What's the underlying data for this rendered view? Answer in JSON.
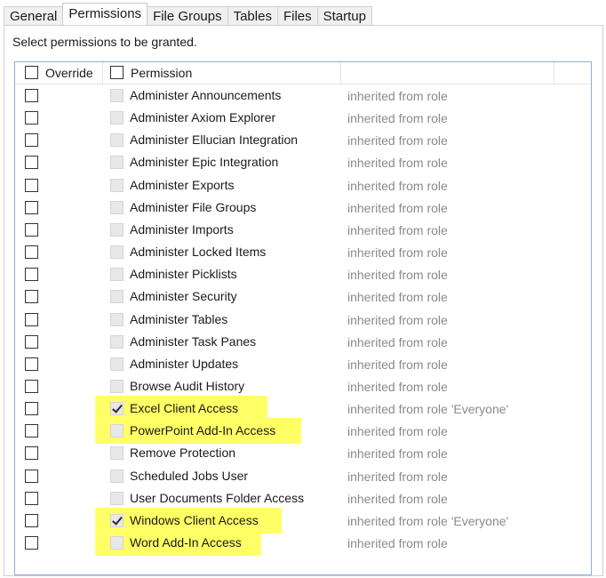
{
  "tabs": [
    {
      "label": "General",
      "active": false
    },
    {
      "label": "Permissions",
      "active": true
    },
    {
      "label": "File Groups",
      "active": false
    },
    {
      "label": "Tables",
      "active": false
    },
    {
      "label": "Files",
      "active": false
    },
    {
      "label": "Startup",
      "active": false
    }
  ],
  "instruction": "Select permissions to be granted.",
  "columns": {
    "override": "Override",
    "permission": "Permission"
  },
  "highlight_color": "#ffff66",
  "rows": [
    {
      "name": "Administer Announcements",
      "inherited": "inherited from role",
      "override": false,
      "granted": false,
      "highlighted": false
    },
    {
      "name": "Administer Axiom Explorer",
      "inherited": "inherited from role",
      "override": false,
      "granted": false,
      "highlighted": false
    },
    {
      "name": "Administer Ellucian Integration",
      "inherited": "inherited from role",
      "override": false,
      "granted": false,
      "highlighted": false
    },
    {
      "name": "Administer Epic Integration",
      "inherited": "inherited from role",
      "override": false,
      "granted": false,
      "highlighted": false
    },
    {
      "name": "Administer Exports",
      "inherited": "inherited from role",
      "override": false,
      "granted": false,
      "highlighted": false
    },
    {
      "name": "Administer File Groups",
      "inherited": "inherited from role",
      "override": false,
      "granted": false,
      "highlighted": false
    },
    {
      "name": "Administer Imports",
      "inherited": "inherited from role",
      "override": false,
      "granted": false,
      "highlighted": false
    },
    {
      "name": "Administer Locked Items",
      "inherited": "inherited from role",
      "override": false,
      "granted": false,
      "highlighted": false
    },
    {
      "name": "Administer Picklists",
      "inherited": "inherited from role",
      "override": false,
      "granted": false,
      "highlighted": false
    },
    {
      "name": "Administer Security",
      "inherited": "inherited from role",
      "override": false,
      "granted": false,
      "highlighted": false
    },
    {
      "name": "Administer Tables",
      "inherited": "inherited from role",
      "override": false,
      "granted": false,
      "highlighted": false
    },
    {
      "name": "Administer Task Panes",
      "inherited": "inherited from role",
      "override": false,
      "granted": false,
      "highlighted": false
    },
    {
      "name": "Administer Updates",
      "inherited": "inherited from role",
      "override": false,
      "granted": false,
      "highlighted": false
    },
    {
      "name": "Browse Audit History",
      "inherited": "inherited from role",
      "override": false,
      "granted": false,
      "highlighted": false
    },
    {
      "name": "Excel Client Access",
      "inherited": "inherited from role 'Everyone'",
      "override": false,
      "granted": true,
      "highlighted": true
    },
    {
      "name": "PowerPoint Add-In Access",
      "inherited": "inherited from role",
      "override": false,
      "granted": false,
      "highlighted": true
    },
    {
      "name": "Remove Protection",
      "inherited": "inherited from role",
      "override": false,
      "granted": false,
      "highlighted": false
    },
    {
      "name": "Scheduled Jobs User",
      "inherited": "inherited from role",
      "override": false,
      "granted": false,
      "highlighted": false
    },
    {
      "name": "User Documents Folder Access",
      "inherited": "inherited from role",
      "override": false,
      "granted": false,
      "highlighted": false
    },
    {
      "name": "Windows Client Access",
      "inherited": "inherited from role 'Everyone'",
      "override": false,
      "granted": true,
      "highlighted": true
    },
    {
      "name": "Word Add-In Access",
      "inherited": "inherited from role",
      "override": false,
      "granted": false,
      "highlighted": true
    }
  ]
}
